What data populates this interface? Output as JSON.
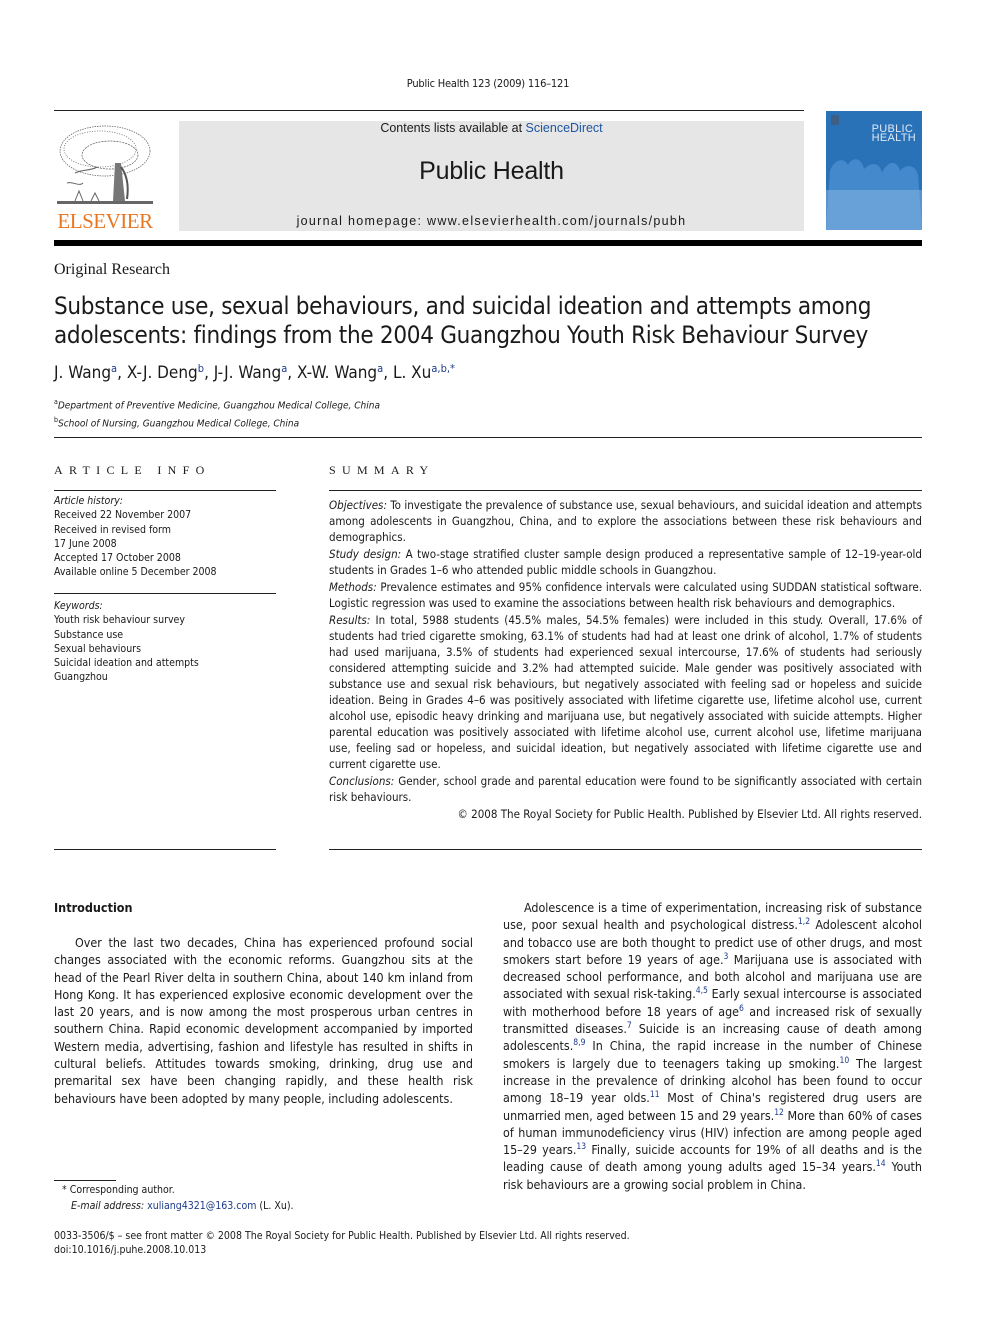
{
  "running_head": "Public Health 123 (2009) 116–121",
  "masthead": {
    "publisher_logo_text": "ELSEVIER",
    "contents_prefix": "Contents lists available at ",
    "contents_link": "ScienceDirect",
    "journal_name": "Public Health",
    "homepage": "journal homepage: www.elsevierhealth.com/journals/pubh",
    "cover_title_line1": "PUBLIC",
    "cover_title_line2": "HEALTH",
    "colors": {
      "elsevier_orange": "#e87722",
      "link_blue": "#1e56a0",
      "cover_blue": "#2a72b8",
      "masthead_gray": "#e6e6e6"
    }
  },
  "article": {
    "section_type": "Original Research",
    "title": "Substance use, sexual behaviours, and suicidal ideation and attempts among adolescents: findings from the 2004 Guangzhou Youth Risk Behaviour Survey",
    "authors": [
      {
        "name": "J. Wang",
        "aff": "a"
      },
      {
        "name": "X-J. Deng",
        "aff": "b"
      },
      {
        "name": "J-J. Wang",
        "aff": "a"
      },
      {
        "name": "X-W. Wang",
        "aff": "a"
      },
      {
        "name": "L. Xu",
        "aff": "a,b,*"
      }
    ],
    "affiliations": [
      {
        "mark": "a",
        "text": "Department of Preventive Medicine, Guangzhou Medical College, China"
      },
      {
        "mark": "b",
        "text": "School of Nursing, Guangzhou Medical College, China"
      }
    ]
  },
  "article_info": {
    "heading": "ARTICLE INFO",
    "history_label": "Article history:",
    "history": [
      "Received 22 November 2007",
      "Received in revised form",
      "17 June 2008",
      "Accepted 17 October 2008",
      "Available online 5 December 2008"
    ],
    "keywords_label": "Keywords:",
    "keywords": [
      "Youth risk behaviour survey",
      "Substance use",
      "Sexual behaviours",
      "Suicidal ideation and attempts",
      "Guangzhou"
    ]
  },
  "summary": {
    "heading": "SUMMARY",
    "sections": [
      {
        "label": "Objectives:",
        "text": " To investigate the prevalence of substance use, sexual behaviours, and suicidal ideation and attempts among adolescents in Guangzhou, China, and to explore the associations between these risk behaviours and demographics."
      },
      {
        "label": "Study design:",
        "text": " A two-stage stratified cluster sample design produced a representative sample of 12–19-year-old students in Grades 1–6 who attended public middle schools in Guangzhou."
      },
      {
        "label": "Methods:",
        "text": " Prevalence estimates and 95% confidence intervals were calculated using SUDDAN statistical software. Logistic regression was used to examine the associations between health risk behaviours and demographics."
      },
      {
        "label": "Results:",
        "text": " In total, 5988 students (45.5% males, 54.5% females) were included in this study. Overall, 17.6% of students had tried cigarette smoking, 63.1% of students had had at least one drink of alcohol, 1.7% of students had used marijuana, 3.5% of students had experienced sexual intercourse, 17.6% of students had seriously considered attempting suicide and 3.2% had attempted suicide. Male gender was positively associated with substance use and sexual risk behaviours, but negatively associated with feeling sad or hopeless and suicide ideation. Being in Grades 4–6 was positively associated with lifetime cigarette use, lifetime alcohol use, current alcohol use, episodic heavy drinking and marijuana use, but negatively associated with suicide attempts. Higher parental education was positively associated with lifetime alcohol use, current alcohol use, lifetime marijuana use, feeling sad or hopeless, and suicidal ideation, but negatively associated with lifetime cigarette use and current cigarette use."
      },
      {
        "label": "Conclusions:",
        "text": " Gender, school grade and parental education were found to be significantly associated with certain risk behaviours."
      }
    ],
    "copyright": "© 2008 The Royal Society for Public Health. Published by Elsevier Ltd. All rights reserved."
  },
  "body": {
    "intro_heading": "Introduction",
    "left_paragraph": "Over the last two decades, China has experienced profound social changes associated with the economic reforms. Guangzhou sits at the head of the Pearl River delta in southern China, about 140 km inland from Hong Kong. It has experienced explosive economic development over the last 20 years, and is now among the most prosperous urban centres in southern China. Rapid economic development accompanied by imported Western media, advertising, fashion and lifestyle has resulted in shifts in cultural beliefs. Attitudes towards smoking, drinking, drug use and premarital sex have been changing rapidly, and these health risk behaviours have been adopted by many people, including adolescents.",
    "right_segments": [
      {
        "t": "Adolescence is a time of experimentation, increasing risk of substance use, poor sexual health and psychological distress.",
        "ref": "1,2"
      },
      {
        "t": " Adolescent alcohol and tobacco use are both thought to predict use of other drugs, and most smokers start before 19 years of age.",
        "ref": "3"
      },
      {
        "t": " Marijuana use is associated with decreased school performance, and both alcohol and marijuana use are associated with sexual risk-taking.",
        "ref": "4,5"
      },
      {
        "t": " Early sexual intercourse is associated with motherhood before 18 years of age",
        "ref": "6"
      },
      {
        "t": " and increased risk of sexually transmitted diseases.",
        "ref": "7"
      },
      {
        "t": " Suicide is an increasing cause of death among adolescents.",
        "ref": "8,9"
      },
      {
        "t": " In China, the rapid increase in the number of Chinese smokers is largely due to teenagers taking up smoking.",
        "ref": "10"
      },
      {
        "t": " The largest increase in the prevalence of drinking alcohol has been found to occur among 18–19 year olds.",
        "ref": "11"
      },
      {
        "t": " Most of China's registered drug users are unmarried men, aged between 15 and 29 years.",
        "ref": "12"
      },
      {
        "t": " More than 60% of cases of human immunodeficiency virus (HIV) infection are among people aged 15–29 years.",
        "ref": "13"
      },
      {
        "t": " Finally, suicide accounts for 19% of all deaths and is the leading cause of death among young adults aged 15–34 years.",
        "ref": "14"
      },
      {
        "t": " Youth risk behaviours are a growing social problem in China.",
        "ref": ""
      }
    ]
  },
  "footnote": {
    "star_text": "*  Corresponding author.",
    "email_label": "E-mail address:",
    "email": "xuliang4321@163.com",
    "email_suffix": " (L. Xu)."
  },
  "bottom_meta": {
    "issn_line": "0033-3506/$ – see front matter © 2008 The Royal Society for Public Health. Published by Elsevier Ltd. All rights reserved.",
    "doi": "doi:10.1016/j.puhe.2008.10.013"
  }
}
